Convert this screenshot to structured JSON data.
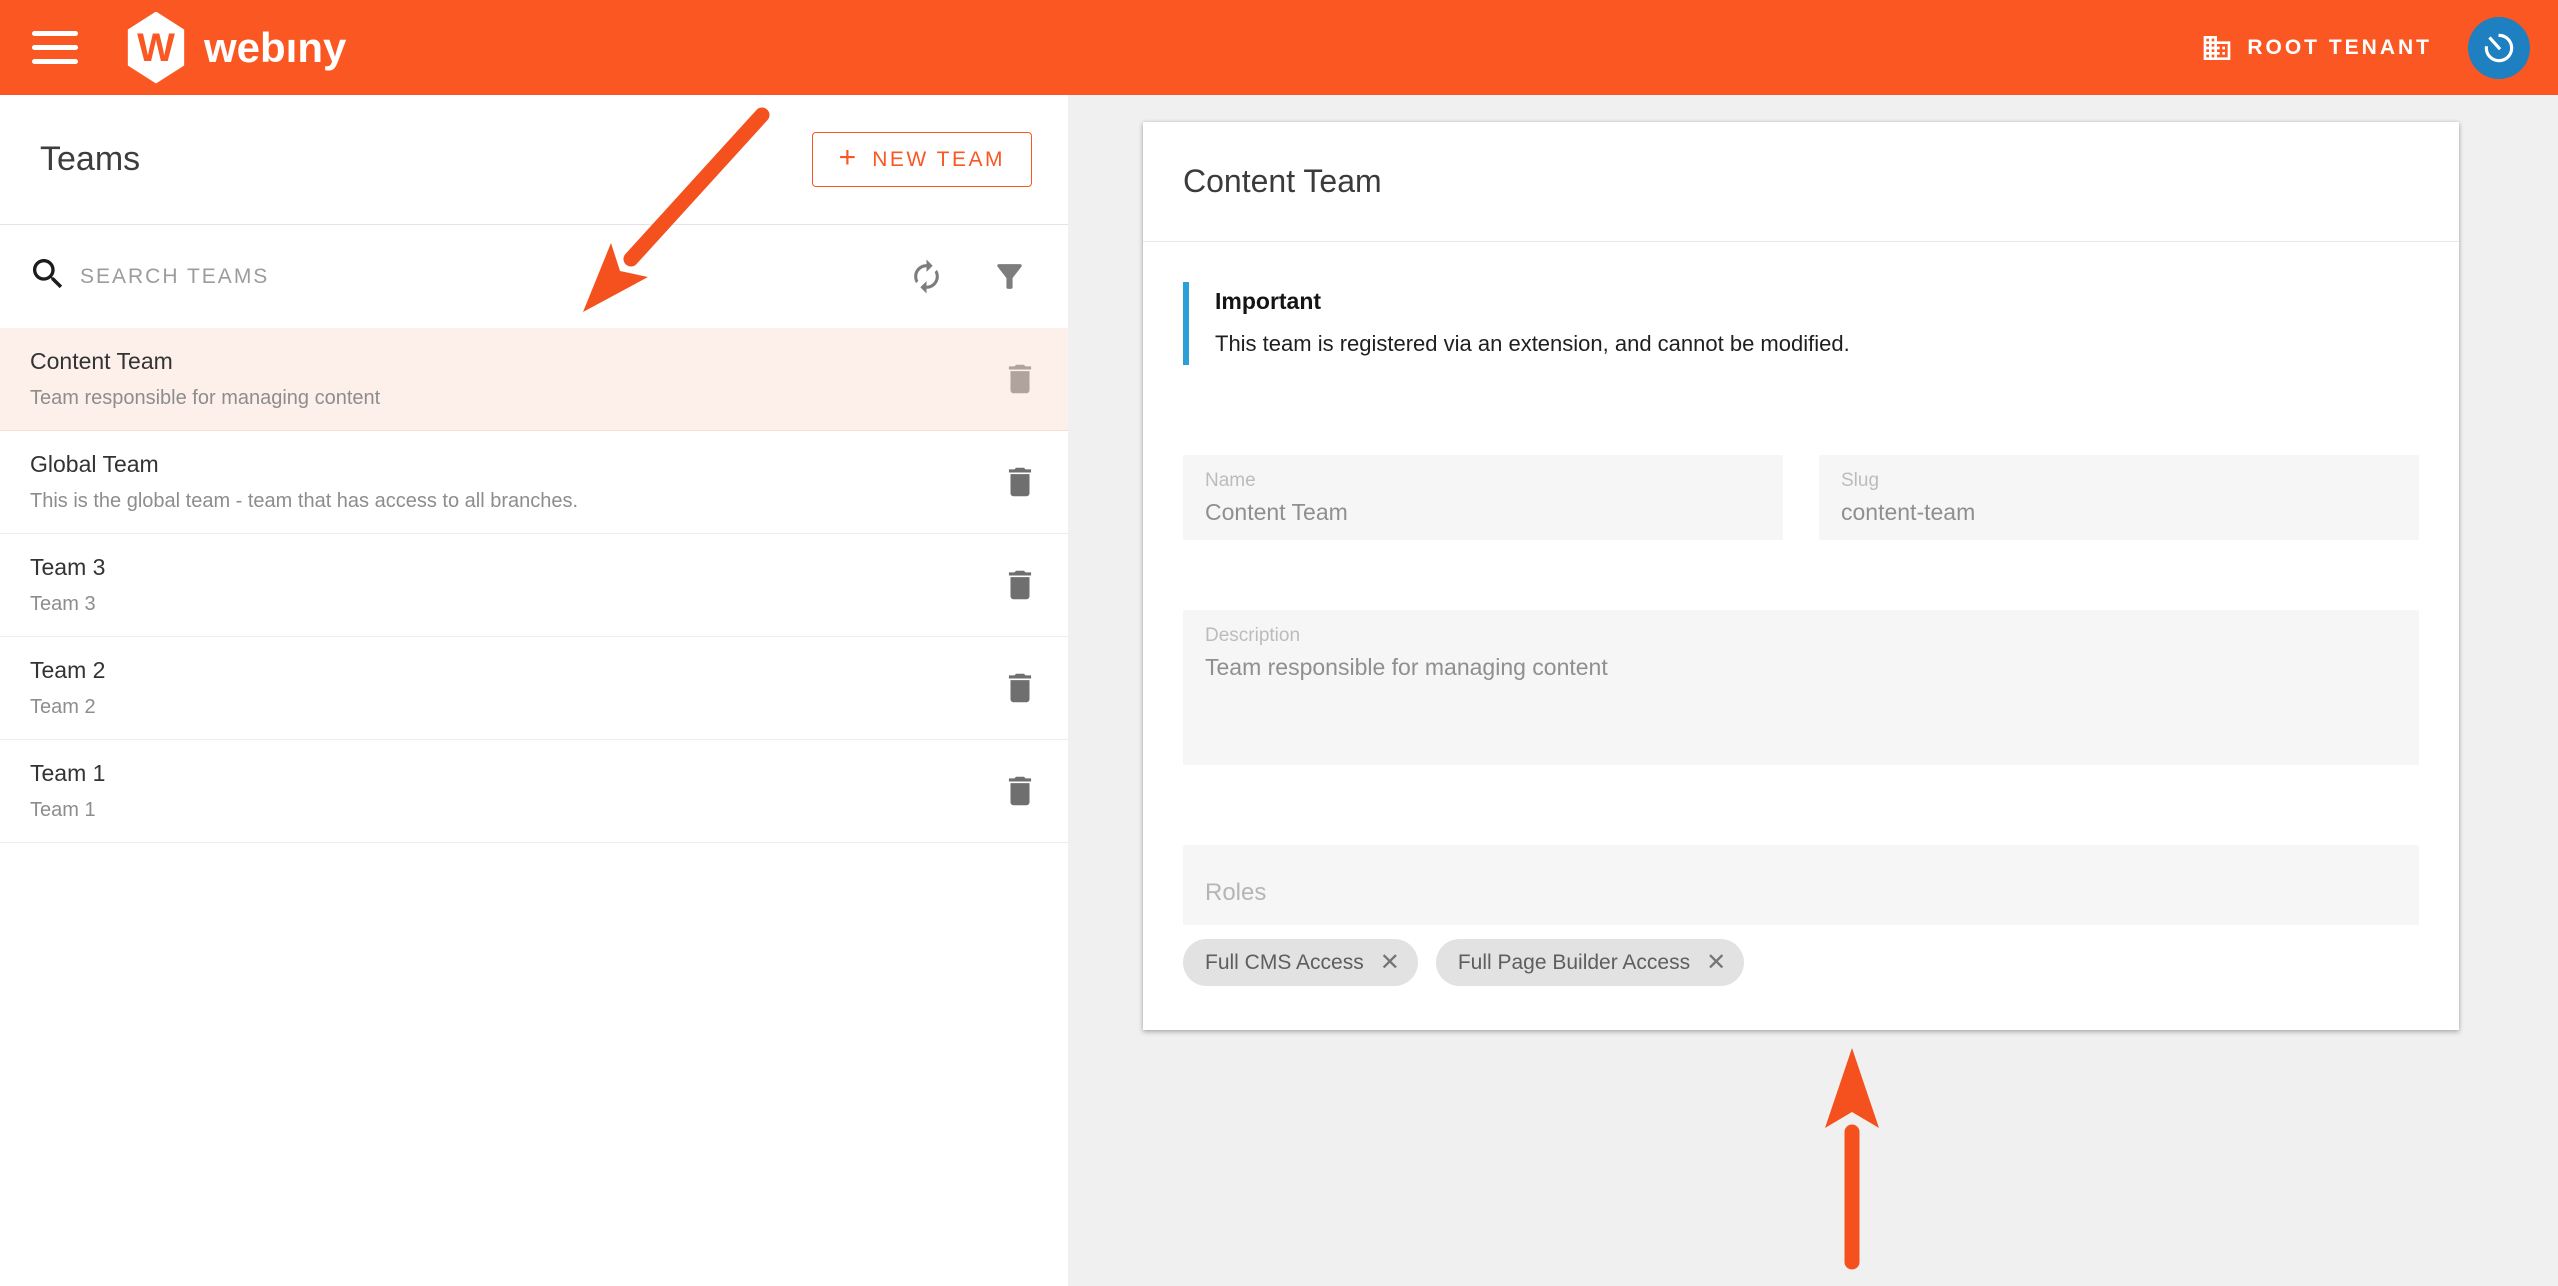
{
  "topbar": {
    "brand": "webıny",
    "logo_letter": "W",
    "tenant_label": "ROOT TENANT"
  },
  "left_panel": {
    "title": "Teams",
    "new_team_button": {
      "icon": "+",
      "label": "NEW TEAM"
    },
    "search_placeholder": "SEARCH TEAMS",
    "teams": [
      {
        "name": "Content Team",
        "description": "Team responsible for managing content",
        "selected": true
      },
      {
        "name": "Global Team",
        "description": "This is the global team - team that has access to all branches.",
        "selected": false
      },
      {
        "name": "Team 3",
        "description": "Team 3",
        "selected": false
      },
      {
        "name": "Team 2",
        "description": "Team 2",
        "selected": false
      },
      {
        "name": "Team 1",
        "description": "Team 1",
        "selected": false
      }
    ]
  },
  "detail_panel": {
    "title": "Content Team",
    "notice": {
      "title": "Important",
      "body": "This team is registered via an extension, and cannot be modified."
    },
    "fields": {
      "name": {
        "label": "Name",
        "value": "Content Team"
      },
      "slug": {
        "label": "Slug",
        "value": "content-team"
      },
      "description": {
        "label": "Description",
        "value": "Team responsible for managing content"
      },
      "roles": {
        "label": "Roles"
      }
    },
    "role_chips": [
      "Full CMS Access",
      "Full Page Builder Access"
    ],
    "chip_remove_glyph": "✕"
  },
  "colors": {
    "topbar_orange": "#fa5723",
    "annotation_arrow_orange": "#f4511e",
    "notice_blue": "#2d9fd8",
    "selected_row_bg": "#fdf0ea",
    "avatar_blue": "#1e7fc1",
    "content_background": "#f0f0f0"
  }
}
